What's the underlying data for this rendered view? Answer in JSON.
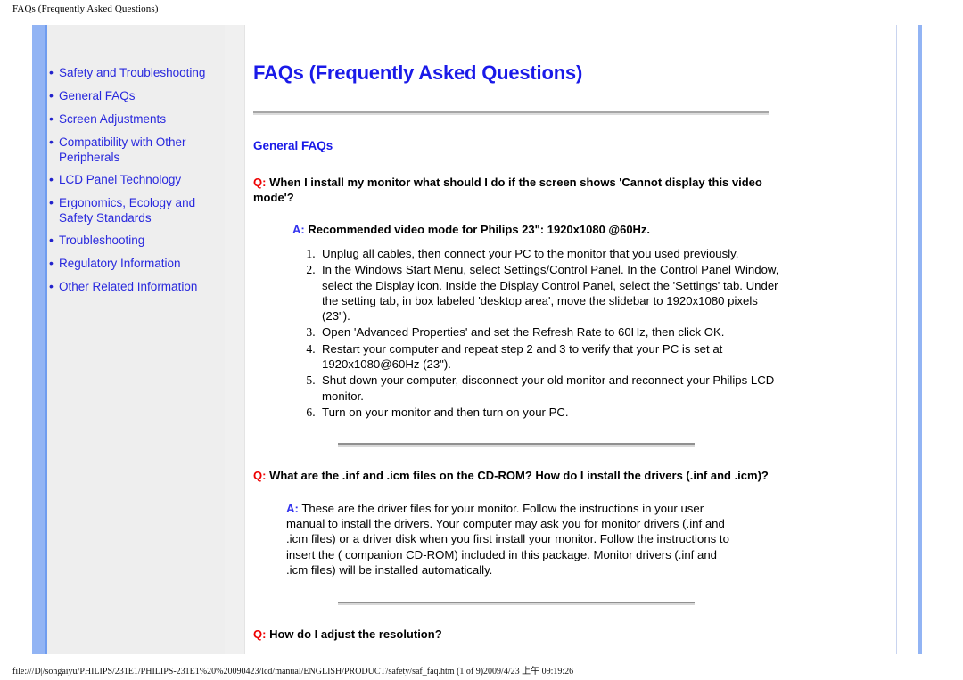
{
  "browser": {
    "print_header": "FAQs (Frequently Asked Questions)"
  },
  "sidebar": {
    "items": [
      {
        "label": "Safety and Troubleshooting"
      },
      {
        "label": "General FAQs"
      },
      {
        "label": "Screen Adjustments"
      },
      {
        "label": "Compatibility with Other Peripherals"
      },
      {
        "label": "LCD Panel Technology"
      },
      {
        "label": "Ergonomics, Ecology and Safety Standards"
      },
      {
        "label": "Troubleshooting"
      },
      {
        "label": "Regulatory Information"
      },
      {
        "label": "Other Related Information"
      }
    ],
    "bullet": "•"
  },
  "main": {
    "title": "FAQs (Frequently Asked Questions)",
    "section_title": "General FAQs",
    "q_marker": "Q:",
    "a_marker": "A:",
    "faqs": [
      {
        "question": "When I install my monitor what should I do if the screen shows 'Cannot display this video mode'?",
        "answer_lead": "Recommended video mode for Philips 23\": 1920x1080 @60Hz.",
        "steps": [
          "Unplug all cables, then connect your PC to the monitor that you used previously.",
          "In the Windows Start Menu, select Settings/Control Panel. In the Control Panel Window, select the Display icon. Inside the Display Control Panel, select the 'Settings' tab. Under the setting tab, in box labeled 'desktop area', move the slidebar to 1920x1080 pixels (23\").",
          "Open 'Advanced Properties' and set the Refresh Rate to 60Hz, then click OK.",
          "Restart your computer and repeat step 2 and 3 to verify that your PC is set at 1920x1080@60Hz (23\").",
          "Shut down your computer, disconnect your old monitor and reconnect your Philips LCD monitor.",
          "Turn on your monitor and then turn on your PC."
        ]
      },
      {
        "question": "What are the .inf and .icm files on the CD-ROM? How do I install the drivers (.inf and .icm)?",
        "answer": "These are the driver files for your monitor. Follow the instructions in your user manual to install the drivers. Your computer may ask you for monitor drivers (.inf and .icm files) or a driver disk when you first install your monitor. Follow the instructions to insert the ( companion CD-ROM) included in this package. Monitor drivers (.inf and .icm files) will be installed automatically."
      },
      {
        "question": "How do I adjust the resolution?"
      }
    ]
  },
  "footer": {
    "path": "file:///D|/songaiyu/PHILIPS/231E1/PHILIPS-231E1%20%20090423/lcd/manual/ENGLISH/PRODUCT/safety/saf_faq.htm (1 of 9)2009/4/23 上午 09:19:26"
  },
  "colors": {
    "link_blue": "#2828dd",
    "title_blue": "#1a1ae8",
    "q_red": "#ee0000",
    "a_blue": "#3333ee",
    "accent_bar": "#92b4f4",
    "sidebar_bg": "#eeeeee"
  }
}
